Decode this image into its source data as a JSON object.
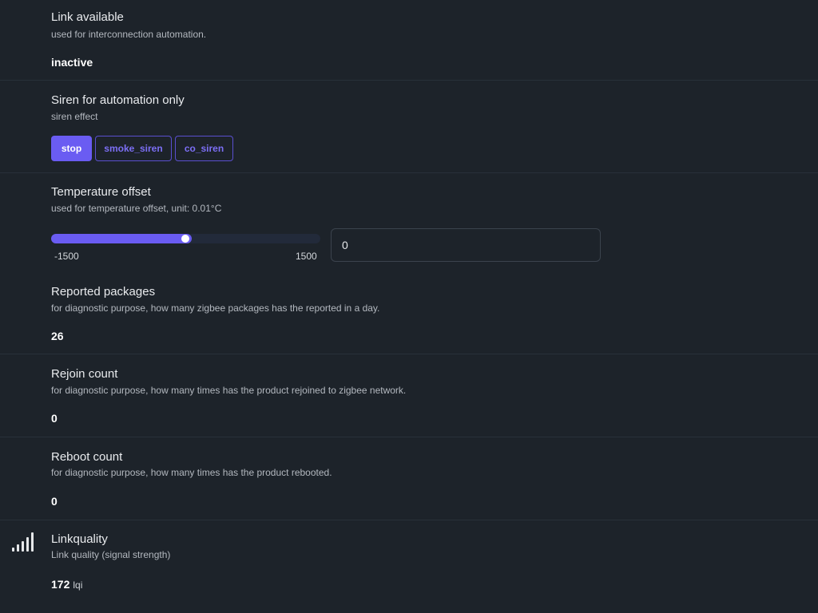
{
  "link_available": {
    "title": "Link available",
    "desc": "used for interconnection automation.",
    "value": "inactive"
  },
  "siren": {
    "title": "Siren for automation only",
    "desc": "siren effect",
    "options": [
      "stop",
      "smoke_siren",
      "co_siren"
    ],
    "selected": "stop"
  },
  "temperature_offset": {
    "title": "Temperature offset",
    "desc": "used for temperature offset, unit: 0.01°C",
    "min_label": "-1500",
    "max_label": "1500",
    "min": -1500,
    "max": 1500,
    "value": 0,
    "input_value": "0"
  },
  "reported_packages": {
    "title": "Reported packages",
    "desc": "for diagnostic purpose, how many zigbee packages has the reported in a day.",
    "value": "26"
  },
  "rejoin_count": {
    "title": "Rejoin count",
    "desc": "for diagnostic purpose, how many times has the product rejoined to zigbee network.",
    "value": "0"
  },
  "reboot_count": {
    "title": "Reboot count",
    "desc": "for diagnostic purpose, how many times has the product rebooted.",
    "value": "0"
  },
  "linkquality": {
    "icon": "signal-strength-icon",
    "title": "Linkquality",
    "desc": "Link quality (signal strength)",
    "value": "172",
    "unit": "lqi"
  },
  "colors": {
    "background": "#1d232a",
    "accent": "#6a5cf2",
    "divider": "#283039"
  }
}
